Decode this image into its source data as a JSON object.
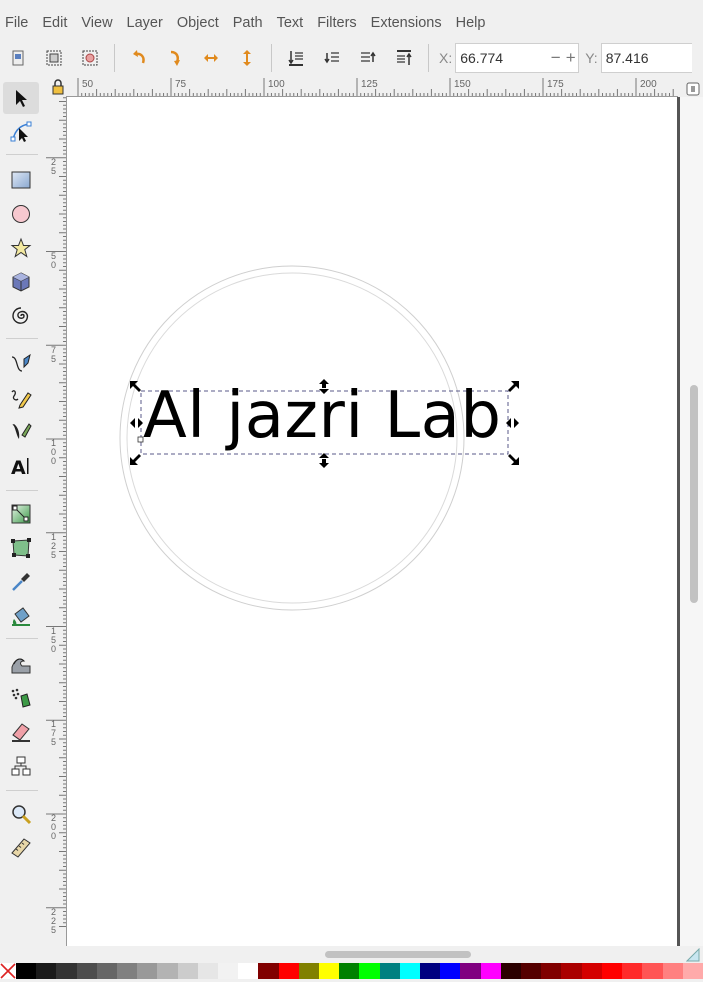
{
  "menu": [
    "File",
    "Edit",
    "View",
    "Layer",
    "Object",
    "Path",
    "Text",
    "Filters",
    "Extensions",
    "Help"
  ],
  "commands": {
    "x_label": "X:",
    "x_value": "66.774",
    "y_label": "Y:",
    "y_value": "87.416",
    "minus": "−",
    "plus": "+"
  },
  "ruler_top": [
    "50",
    "75",
    "100",
    "125",
    "150",
    "175",
    "200"
  ],
  "ruler_left": [
    "25",
    "50",
    "75",
    "100",
    "125",
    "150",
    "175",
    "200",
    "225"
  ],
  "canvas": {
    "text": "Al jazri Lab"
  },
  "palette": [
    "#000000",
    "#1a1a1a",
    "#333333",
    "#4d4d4d",
    "#666666",
    "#808080",
    "#999999",
    "#b3b3b3",
    "#cccccc",
    "#e6e6e6",
    "#f2f2f2",
    "#ffffff",
    "#800000",
    "#ff0000",
    "#808000",
    "#ffff00",
    "#008000",
    "#00ff00",
    "#008080",
    "#00ffff",
    "#000080",
    "#0000ff",
    "#800080",
    "#ff00ff",
    "#2b0000",
    "#550000",
    "#800000",
    "#aa0000",
    "#d40000",
    "#ff0000",
    "#ff2a2a",
    "#ff5555",
    "#ff8080",
    "#ffaaaa"
  ]
}
